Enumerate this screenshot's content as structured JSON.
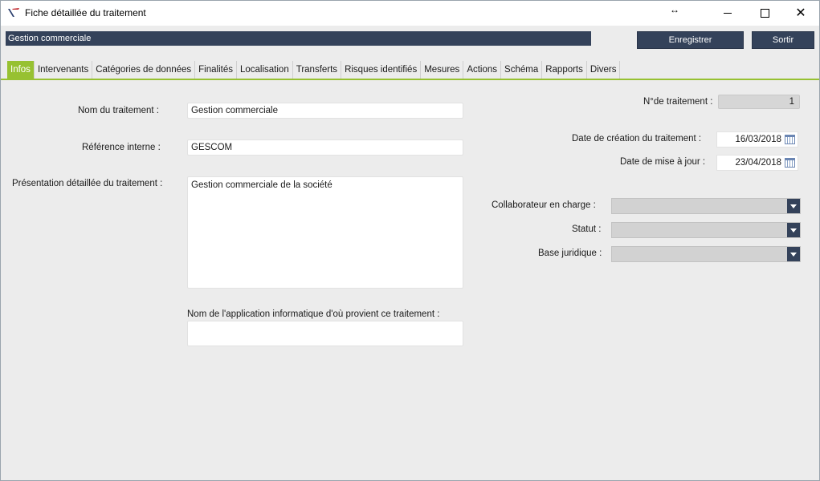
{
  "window": {
    "title": "Fiche détaillée du traitement",
    "resize_glyph": "↔",
    "close_glyph": "✕"
  },
  "record": {
    "name": "Gestion commerciale"
  },
  "toolbar": {
    "save_label": "Enregistrer",
    "exit_label": "Sortir"
  },
  "tabs": [
    "Infos",
    "Intervenants",
    "Catégories de données",
    "Finalités",
    "Localisation",
    "Transferts",
    "Risques identifiés",
    "Mesures",
    "Actions",
    "Schéma",
    "Rapports",
    "Divers"
  ],
  "form": {
    "nom_label": "Nom du traitement :",
    "nom_value": "Gestion commerciale",
    "ref_label": "Référence interne :",
    "ref_value": "GESCOM",
    "presentation_label": "Présentation détaillée du traitement :",
    "presentation_value": "Gestion commerciale de la société",
    "app_label": "Nom de l'application informatique d'où provient ce traitement :",
    "app_value": "",
    "num_label": "N°de traitement :",
    "num_value": "1",
    "date_creation_label": "Date de création du traitement :",
    "date_creation_value": "16/03/2018",
    "date_maj_label": "Date de mise à jour :",
    "date_maj_value": "23/04/2018",
    "collaborateur_label": "Collaborateur en charge :",
    "statut_label": "Statut :",
    "base_label": "Base juridique :"
  },
  "colors": {
    "accent": "#97c132",
    "dark": "#34425a",
    "background": "#ececec"
  }
}
